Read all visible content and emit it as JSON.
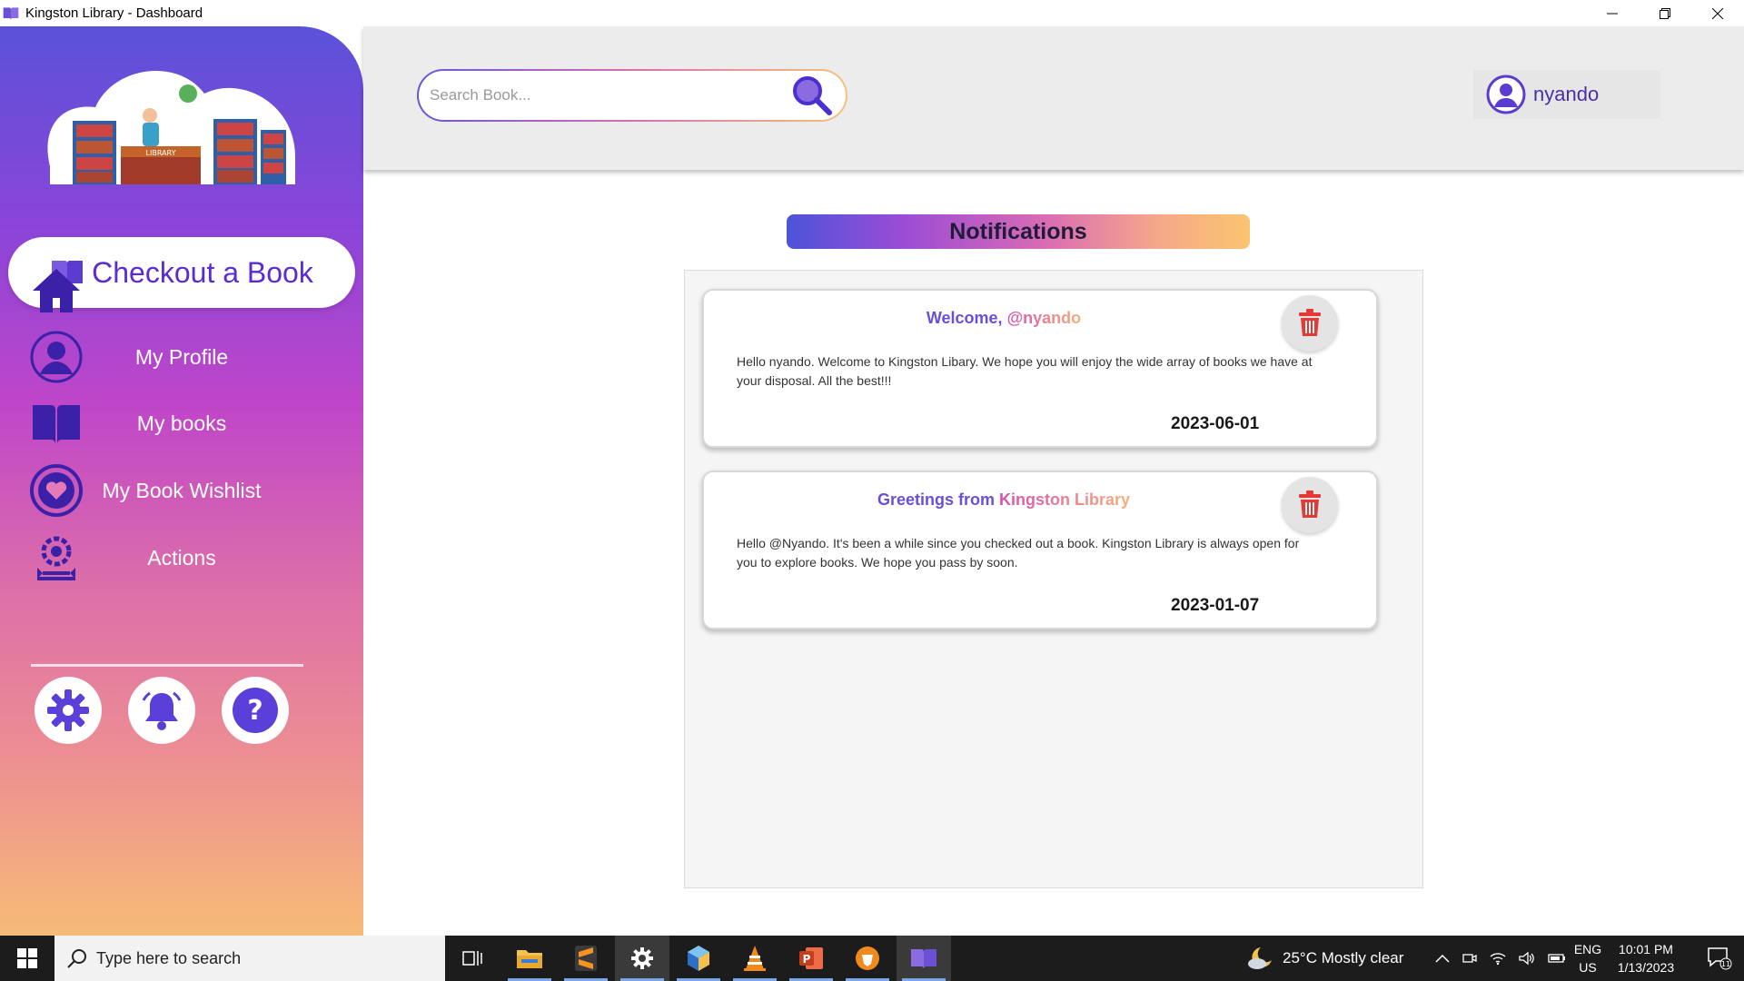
{
  "window": {
    "title": "Kingston Library -  Dashboard"
  },
  "sidebar": {
    "checkout_label": "Checkout a Book",
    "items": [
      {
        "label": "Home",
        "icon": "home-icon"
      },
      {
        "label": "My Profile",
        "icon": "user-icon"
      },
      {
        "label": "My books",
        "icon": "book-icon"
      },
      {
        "label": "My Book Wishlist",
        "icon": "heart-icon"
      },
      {
        "label": "Actions",
        "icon": "actions-icon"
      }
    ],
    "logo_text": "LIBRARY"
  },
  "header": {
    "search_placeholder": "Search Book...",
    "username": "nyando"
  },
  "main": {
    "title": "Notifications",
    "notifications": [
      {
        "title_prefix": "Welcome, ",
        "title_accent": "@nyando",
        "body": "Hello nyando. Welcome to Kingston Libary. We hope you will enjoy the wide array of books we have at your disposal. All the best!!!",
        "date": "2023-06-01"
      },
      {
        "title_prefix": "Greetings from ",
        "title_accent": "Kingston Library",
        "body": "Hello @Nyando. It's been a while since you checked out a book. Kingston Library is always open for you to explore books. We hope you pass by soon.",
        "date": "2023-01-07"
      }
    ]
  },
  "taskbar": {
    "search_text": "Type here to search",
    "weather": "25°C  Mostly clear",
    "lang_top": "ENG",
    "lang_bottom": "US",
    "time": "10:01 PM",
    "date": "1/13/2023",
    "notification_count": "11"
  },
  "colors": {
    "accent": "#5b2bd3",
    "nav_icon": "#4a22b8",
    "trash": "#e53935"
  }
}
